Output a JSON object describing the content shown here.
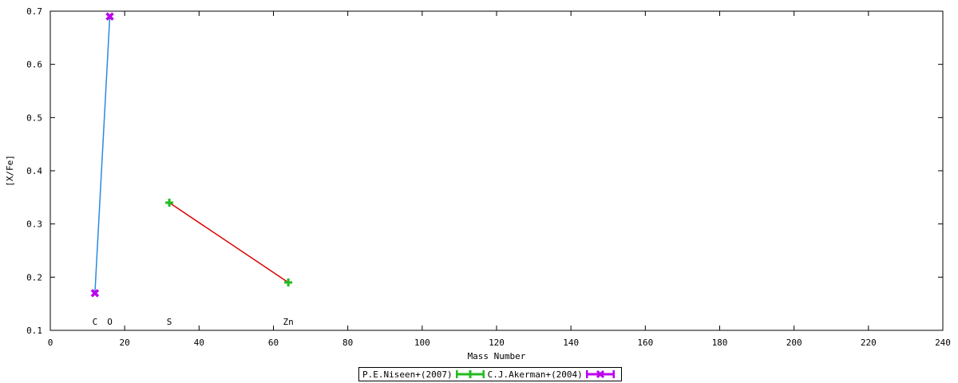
{
  "chart_data": {
    "type": "line",
    "xlabel": "Mass Number",
    "ylabel": "[X/Fe]",
    "xlim": [
      0,
      240
    ],
    "ylim": [
      0.1,
      0.7
    ],
    "xticks": [
      0,
      20,
      40,
      60,
      80,
      100,
      120,
      140,
      160,
      180,
      200,
      220,
      240
    ],
    "yticks": [
      0.1,
      0.2,
      0.3,
      0.4,
      0.5,
      0.6,
      0.7
    ],
    "grid": false,
    "legend_position": "bottom-center",
    "element_labels": [
      {
        "text": "C",
        "x": 12
      },
      {
        "text": "O",
        "x": 16
      },
      {
        "text": "S",
        "x": 32
      },
      {
        "text": "Zn",
        "x": 64
      }
    ],
    "series": [
      {
        "name": "P.E.Niseen+(2007)",
        "marker": "plus",
        "marker_color": "#22bb22",
        "line_color": "#dd0000",
        "points": [
          {
            "x": 32,
            "y": 0.34
          },
          {
            "x": 64,
            "y": 0.19
          }
        ]
      },
      {
        "name": "C.J.Akerman+(2004)",
        "marker": "cross",
        "marker_color": "#bb00ee",
        "line_color": "#2a8adf",
        "points": [
          {
            "x": 12,
            "y": 0.17
          },
          {
            "x": 16,
            "y": 0.69
          }
        ]
      }
    ]
  }
}
